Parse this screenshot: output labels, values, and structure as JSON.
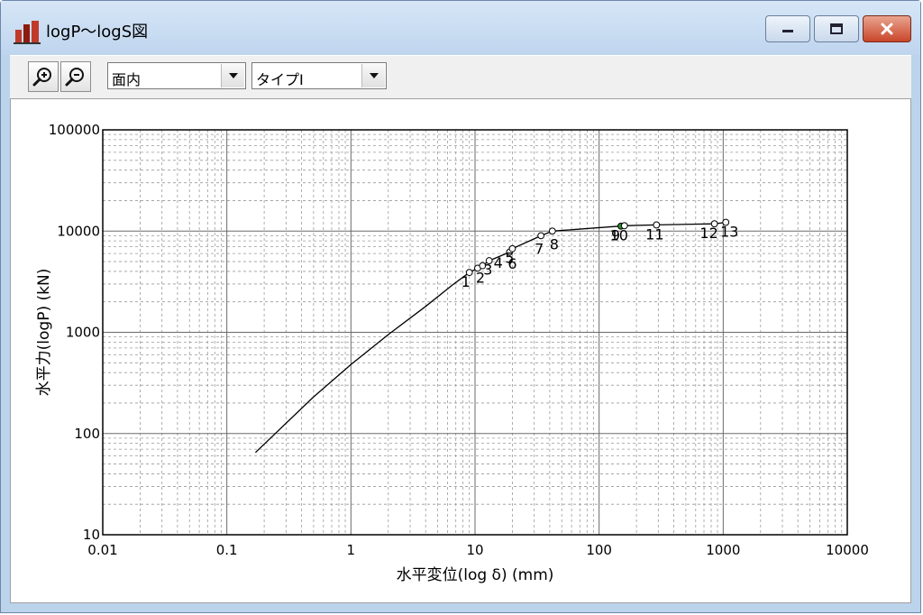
{
  "window": {
    "title": "logP～logS図",
    "icon": "bar-chart-app-icon",
    "min_icon": "minimize-icon",
    "max_icon": "maximize-icon",
    "close_icon": "close-icon"
  },
  "toolbar": {
    "zoom_in_icon": "zoom-in-icon",
    "zoom_out_icon": "zoom-out-icon",
    "direction_select": {
      "value": "面内"
    },
    "type_select": {
      "value": "タイプⅠ"
    }
  },
  "chart_data": {
    "type": "line",
    "xlabel": "水平変位(log δ) (mm)",
    "ylabel": "水平力(logP) (kN)",
    "xscale": "log",
    "yscale": "log",
    "xlim": [
      0.01,
      10000
    ],
    "ylim": [
      10,
      100000
    ],
    "grid": true,
    "xticks": [
      0.01,
      0.1,
      1,
      10,
      100,
      1000,
      10000
    ],
    "xtick_labels": [
      "0.01",
      "0.1",
      "1",
      "10",
      "100",
      "1000",
      "10000"
    ],
    "yticks": [
      10,
      100,
      1000,
      10000,
      100000
    ],
    "ytick_labels": [
      "10",
      "100",
      "1000",
      "10000",
      "100000"
    ],
    "series": [
      {
        "x": [
          0.17,
          0.5,
          1.0,
          2.0,
          4.0,
          6.5,
          9.0,
          10.5,
          11.5,
          13.0,
          19.0,
          20.0,
          34.0,
          42.0,
          150.0,
          160.0,
          290.0,
          850.0,
          1050.0
        ],
        "y": [
          65,
          230,
          480,
          950,
          1800,
          2900,
          3900,
          4300,
          4550,
          5100,
          6200,
          6700,
          9000,
          10000,
          11200,
          11300,
          11500,
          11800,
          12200
        ]
      }
    ],
    "points": [
      {
        "label": "1",
        "x": 9.0,
        "y": 3900
      },
      {
        "label": "2",
        "x": 10.5,
        "y": 4300
      },
      {
        "label": "3",
        "x": 11.5,
        "y": 4550
      },
      {
        "label": "4",
        "x": 13.0,
        "y": 5100
      },
      {
        "label": "5",
        "x": 19.0,
        "y": 6200
      },
      {
        "label": "6",
        "x": 20.0,
        "y": 6700
      },
      {
        "label": "7",
        "x": 34.0,
        "y": 9000
      },
      {
        "label": "8",
        "x": 42.0,
        "y": 10000
      },
      {
        "label": "9",
        "x": 150.0,
        "y": 11200
      },
      {
        "label": "10",
        "x": 160.0,
        "y": 11300
      },
      {
        "label": "11",
        "x": 290.0,
        "y": 11500
      },
      {
        "label": "12",
        "x": 850.0,
        "y": 11800
      },
      {
        "label": "13",
        "x": 1050.0,
        "y": 12200
      }
    ],
    "highlight_point_color": "#2e8b2e"
  }
}
